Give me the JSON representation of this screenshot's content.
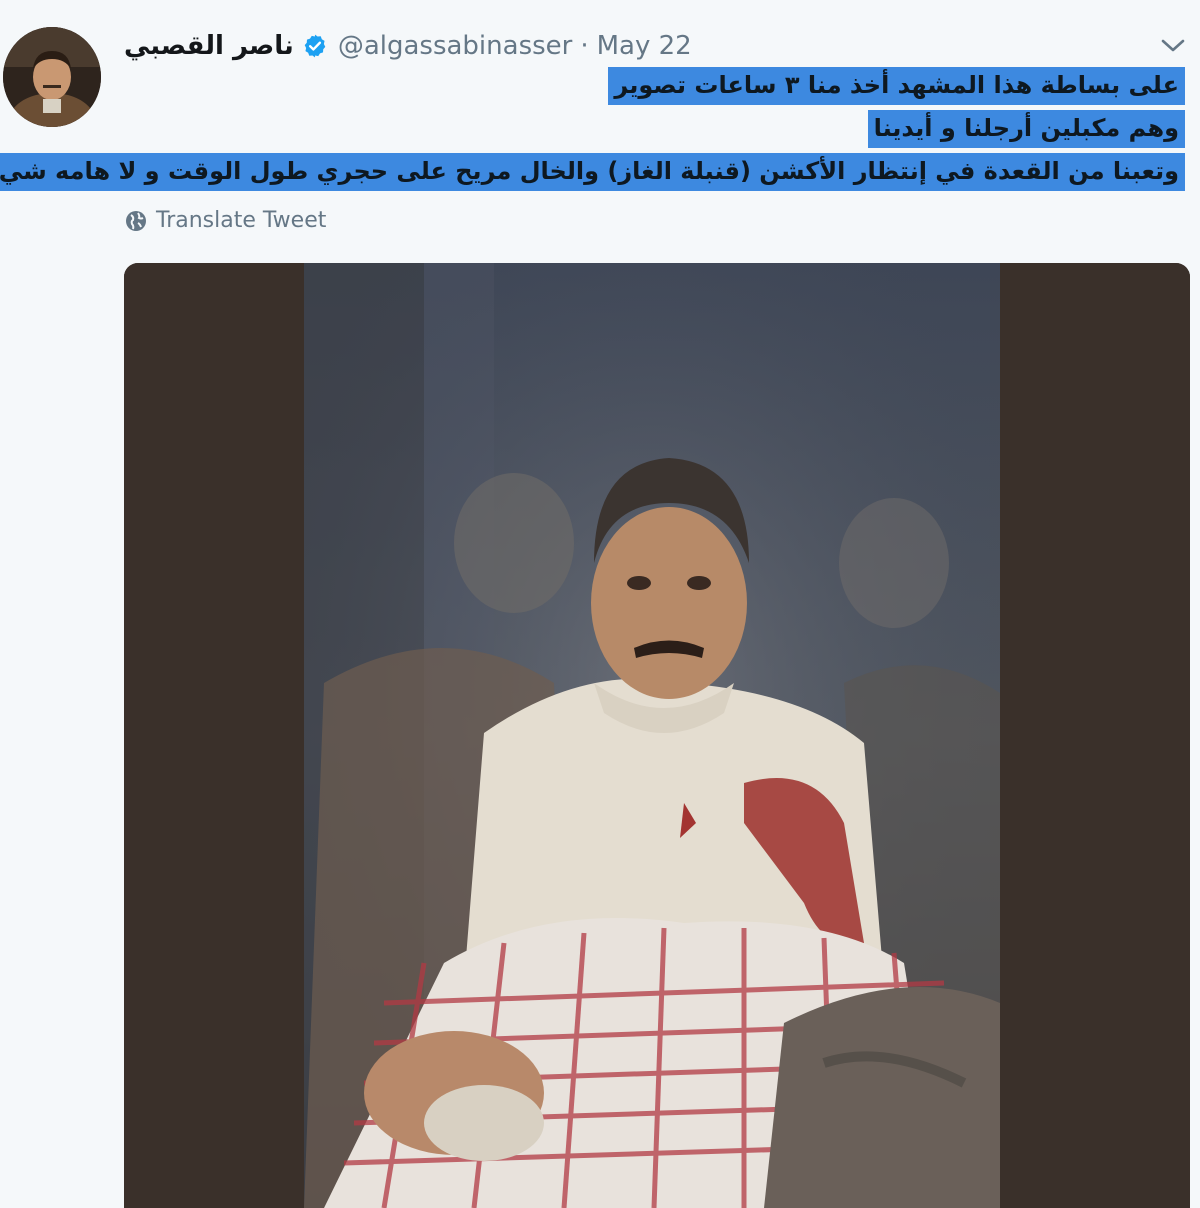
{
  "tweet": {
    "author": {
      "display_name": "ناصر القصبي",
      "handle": "@algassabinasser",
      "verified": true
    },
    "separator": "·",
    "date": "May 22",
    "text_lines": [
      "على بساطة هذا المشهد أخذ منا ٣ ساعات تصوير",
      "وهم  مكبلين أرجلنا و أيدينا",
      "وتعبنا من القعدة   في إنتظار الأكشن (قنبلة الغاز) والخال مريح على حجري طول الوقت و لا هامه شي"
    ],
    "translate_label": "Translate Tweet",
    "highlight_color": "#3d89e0"
  },
  "icons": {
    "verified": "verified-badge-icon",
    "caret": "chevron-down-icon",
    "globe": "globe-icon"
  },
  "colors": {
    "background": "#f5f8fa",
    "secondary_text": "#657786",
    "verified_blue": "#1da1f2"
  }
}
